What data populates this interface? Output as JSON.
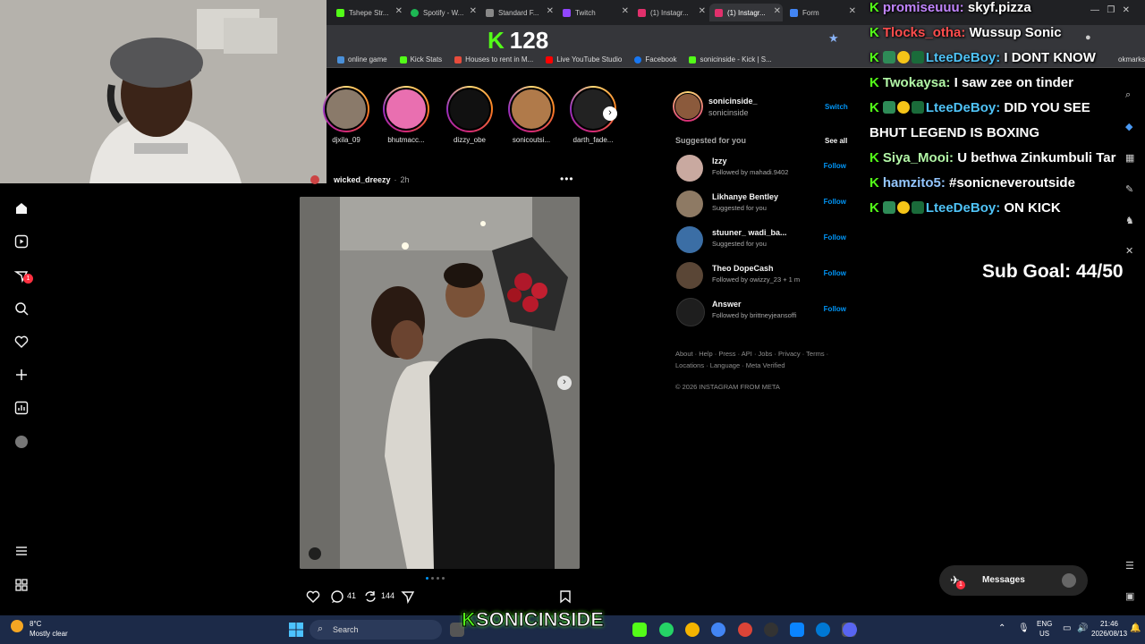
{
  "browser": {
    "tabs": [
      {
        "label": "Tshepe Str...",
        "color": "#53fc18"
      },
      {
        "label": "Spotify - W...",
        "color": "#1db954"
      },
      {
        "label": "Standard F...",
        "color": "#888888"
      },
      {
        "label": "Twitch",
        "color": "#9146ff"
      },
      {
        "label": "(1) Instagr...",
        "color": "#e1306c"
      },
      {
        "label": "(1) Instagr...",
        "color": "#e1306c",
        "active": true
      },
      {
        "label": "Form",
        "color": "#4285f4"
      }
    ],
    "bookmarks": [
      {
        "label": "online game",
        "color": "#4a90d9"
      },
      {
        "label": "Kick Stats",
        "color": "#53fc18"
      },
      {
        "label": "Houses to rent in M...",
        "color": "#e74c3c"
      },
      {
        "label": "Live YouTube Studio",
        "color": "#ff0000"
      },
      {
        "label": "Facebook",
        "color": "#1877f2"
      },
      {
        "label": "sonicinside - Kick | S...",
        "color": "#53fc18"
      }
    ],
    "bookmarks_right": "okmarks"
  },
  "kick_overlay": {
    "viewer_count": "128",
    "logo": "K"
  },
  "stories": [
    {
      "name": "djxila_09",
      "color": "#8a7a6a"
    },
    {
      "name": "bhutmacc...",
      "color": "#e96fb0"
    },
    {
      "name": "dizzy_obe",
      "color": "#111111"
    },
    {
      "name": "sonicoutsi...",
      "color": "#b07a4a"
    },
    {
      "name": "darth_fade...",
      "color": "#222222"
    }
  ],
  "post": {
    "username": "wicked_dreezy",
    "time": "2h",
    "comments": "41",
    "reposts": "144"
  },
  "sidebar": {
    "account_username": "sonicinside_",
    "account_name": "sonicinside",
    "switch_label": "Switch",
    "suggested_title": "Suggested for you",
    "see_all": "See all",
    "follow_label": "Follow",
    "suggestions": [
      {
        "name": "Izzy",
        "sub": "Followed by mahadi.9402",
        "color": "#c9a9a0"
      },
      {
        "name": "Likhanye Bentley",
        "sub": "Suggested for you",
        "color": "#8e7a64"
      },
      {
        "name": "stuuner_ wadi_ba...",
        "sub": "Suggested for you",
        "color": "#3b6ea5"
      },
      {
        "name": "Theo DopeCash",
        "sub": "Followed by owizzy_23 + 1 m",
        "color": "#5a4636"
      },
      {
        "name": "Answer",
        "sub": "Followed by brittneyjeansoffi",
        "color": "#1e1e1e"
      }
    ],
    "footer_line1": "About · Help · Press · API · Jobs · Privacy · Terms ·",
    "footer_line2": "Locations · Language · Meta Verified",
    "copyright": "© 2026 INSTAGRAM FROM META"
  },
  "chat": [
    {
      "user": "promiseuuu:",
      "msg": "skyf.pizza",
      "color": "#c084fc",
      "badges": 0
    },
    {
      "user": "Tlocks_otha:",
      "msg": "Wussup Sonic",
      "color": "#ff4d4d",
      "badges": 0
    },
    {
      "user": "LteeDeBoy:",
      "msg": "I DONT KNOW",
      "color": "#4fc3f7",
      "badges": 3
    },
    {
      "user": "Twokaysa:",
      "msg": "I saw zee on tinder",
      "color": "#b2f7a6",
      "badges": 0
    },
    {
      "user": "LteeDeBoy:",
      "msg": "DID YOU SEE",
      "color": "#4fc3f7",
      "badges": 3
    },
    {
      "user": "",
      "msg": "BHUT LEGEND IS BOXING",
      "color": "#ffffff",
      "badges": -1
    },
    {
      "user": "Siya_Mooi:",
      "msg": "U bethwa Zinkumbuli Tar",
      "color": "#b2f7a6",
      "badges": 0
    },
    {
      "user": "hamzito5:",
      "msg": "#sonicneveroutside",
      "color": "#93c5fd",
      "badges": 0
    },
    {
      "user": "LteeDeBoy:",
      "msg": "ON KICK",
      "color": "#4fc3f7",
      "badges": 3
    }
  ],
  "sub_goal": "Sub Goal: 44/50",
  "messages": {
    "label": "Messages",
    "badge": "1"
  },
  "notif_badge": "1",
  "stream_logo": "SONICINSIDE",
  "taskbar": {
    "weather_temp": "8°C",
    "weather_desc": "Mostly clear",
    "search_placeholder": "Search",
    "lang1": "ENG",
    "lang2": "US",
    "time": "21:46",
    "date": "2026/08/13"
  }
}
